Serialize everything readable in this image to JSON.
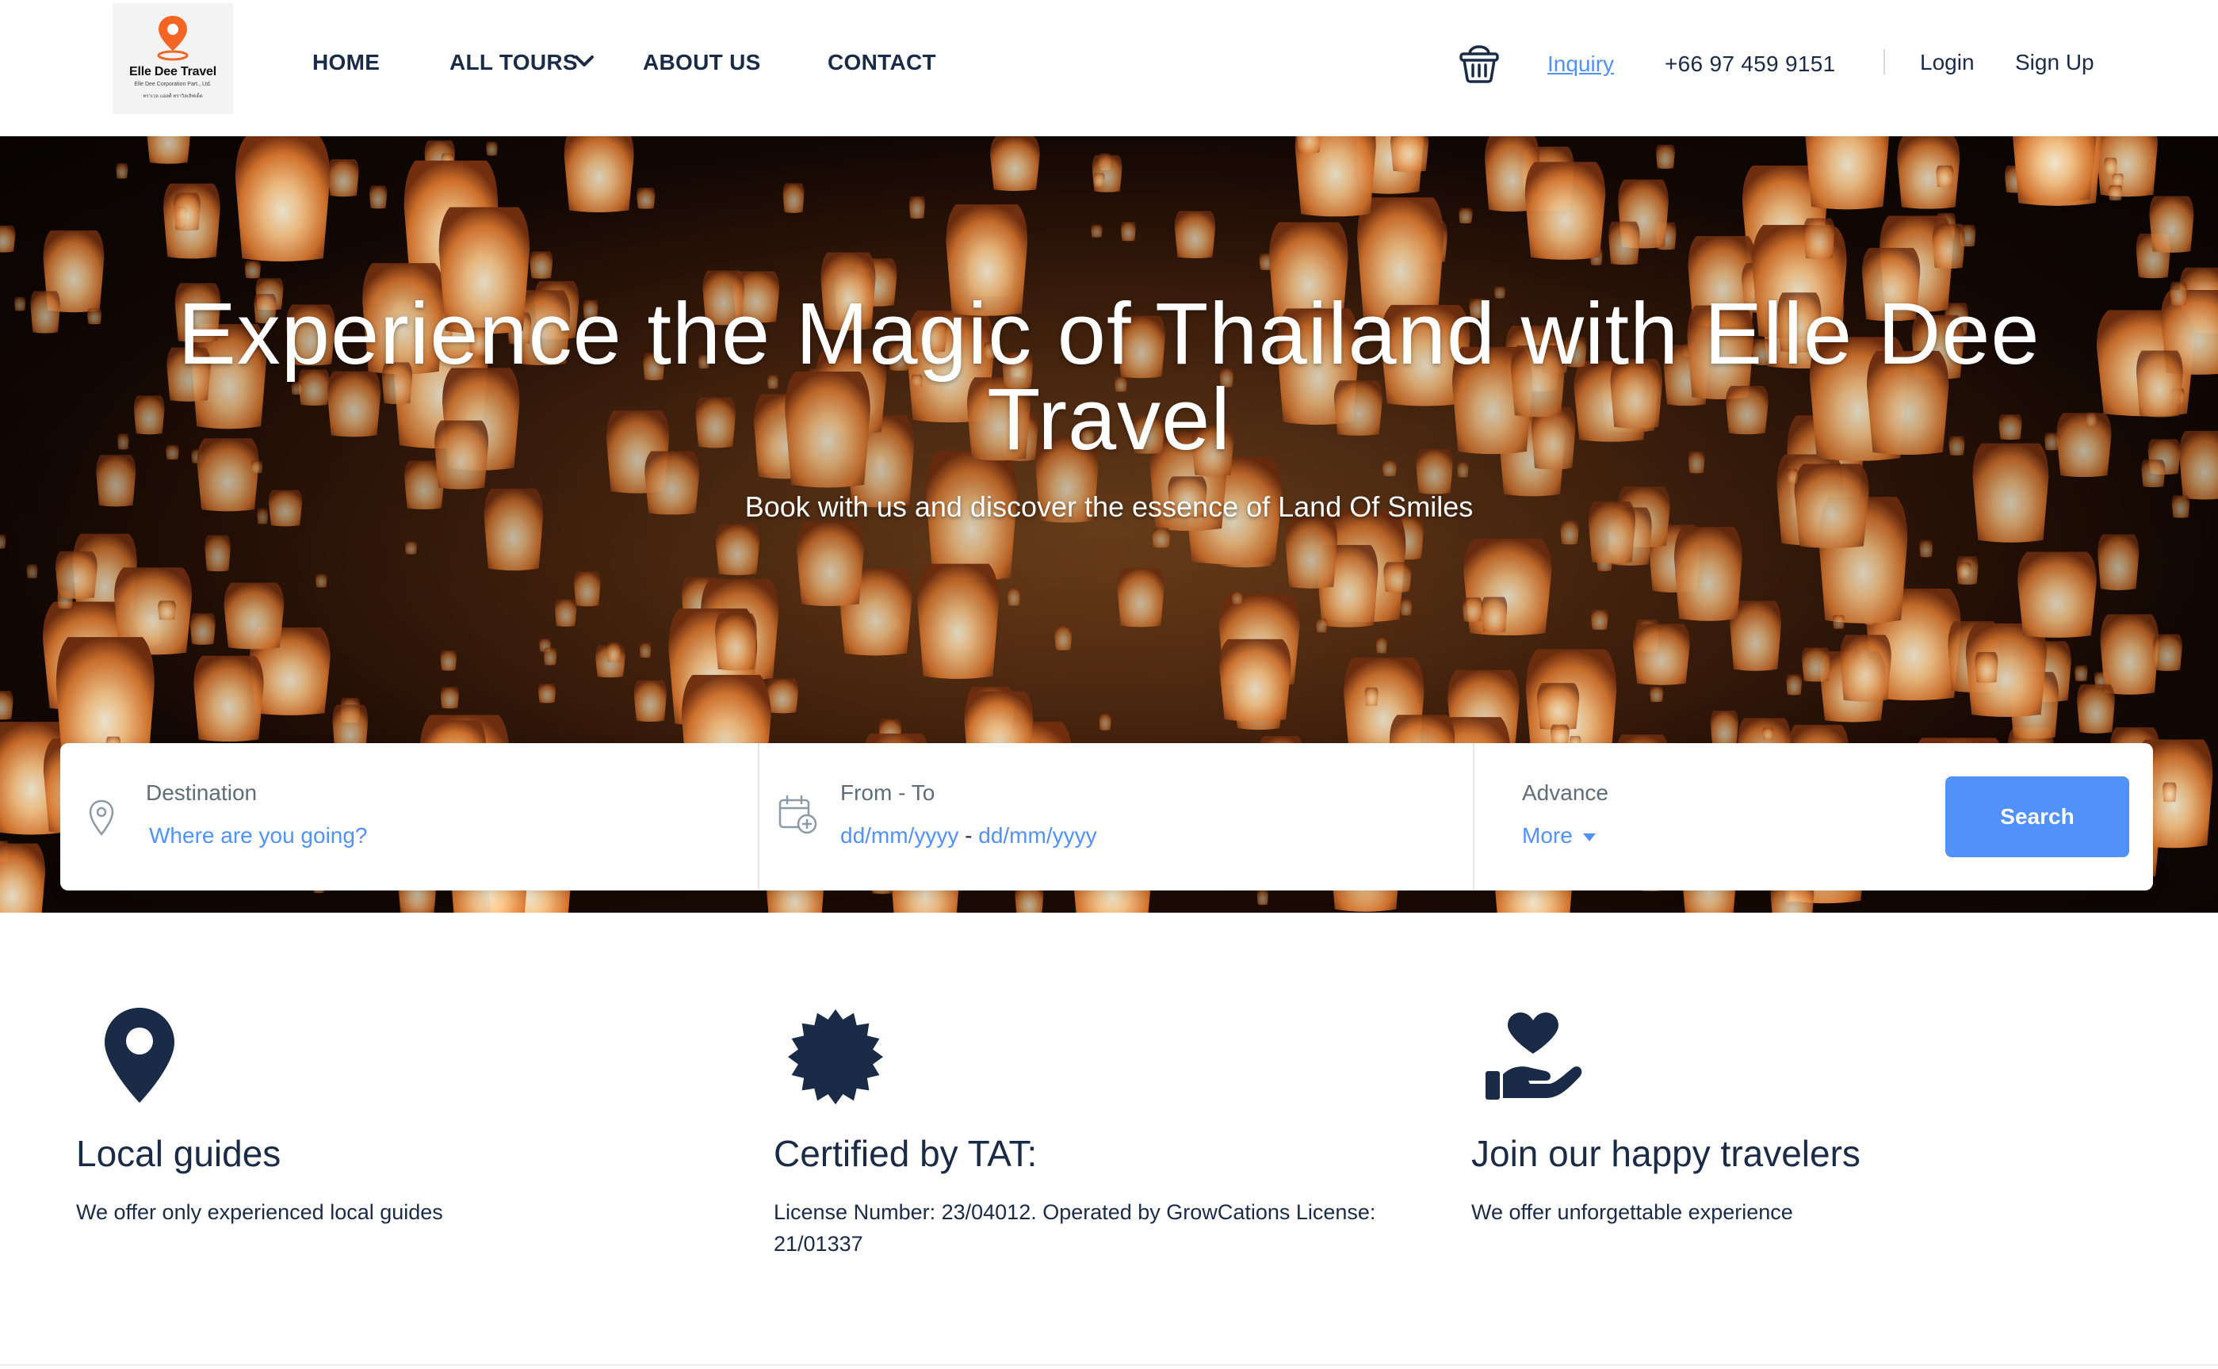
{
  "brand": {
    "name": "Elle Dee Travel",
    "subtitle": "Elle Dee Corporation Part., Ltd.",
    "tagline": "ทราเวล แอลดี ทราวิลเลิฟเด็ด",
    "accent_color": "#f26522"
  },
  "nav": {
    "items": [
      {
        "label": "HOME"
      },
      {
        "label": "ALL TOURS"
      },
      {
        "label": "ABOUT US"
      },
      {
        "label": "CONTACT"
      }
    ],
    "dropdown_icon": "chevron-down-icon"
  },
  "header_right": {
    "cart_icon": "basket-icon",
    "inquiry": "Inquiry",
    "phone": "+66 97 459 9151",
    "login": "Login",
    "signup": "Sign Up"
  },
  "hero": {
    "title": "Experience the Magic of Thailand with Elle Dee Travel",
    "subtitle": "Book with us and discover the essence of Land Of Smiles"
  },
  "search": {
    "destination": {
      "label": "Destination",
      "placeholder": "Where are you going?",
      "icon": "map-pin-icon"
    },
    "dates": {
      "label": "From - To",
      "from": "dd/mm/yyyy",
      "separator": "-",
      "to": "dd/mm/yyyy",
      "icon": "calendar-add-icon"
    },
    "advance": {
      "label": "Advance",
      "more": "More",
      "icon": "caret-down-icon"
    },
    "button": "Search",
    "button_color": "#5191fa"
  },
  "features": [
    {
      "icon": "location-pin-icon",
      "title": "Local guides",
      "desc": "We offer only experienced local guides"
    },
    {
      "icon": "certificate-badge-icon",
      "title": "Certified by TAT:",
      "desc": "License Number: 23/04012. Operated by GrowCations License: 21/01337"
    },
    {
      "icon": "heart-hand-icon",
      "title": "Join our happy travelers",
      "desc": "We offer unforgettable experience"
    }
  ],
  "colors": {
    "text": "#1a2b48",
    "link": "#5191fa",
    "muted": "#5e6d77"
  }
}
